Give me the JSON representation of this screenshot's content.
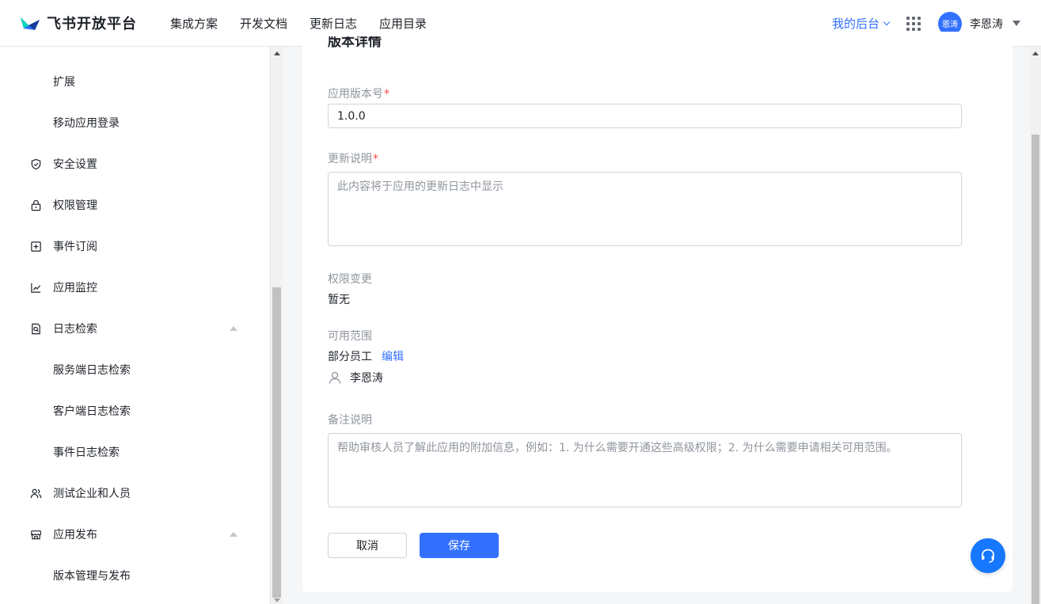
{
  "header": {
    "logo_text": "飞书开放平台",
    "nav": [
      "集成方案",
      "开发文档",
      "更新日志",
      "应用目录"
    ],
    "my_console": "我的后台",
    "avatar_text": "恩涛",
    "user_name": "李恩涛"
  },
  "sidebar": {
    "items": [
      {
        "label": "扩展",
        "icon": "",
        "level": "sub"
      },
      {
        "label": "移动应用登录",
        "icon": "",
        "level": "sub"
      },
      {
        "label": "安全设置",
        "icon": "shield-icon",
        "level": "top"
      },
      {
        "label": "权限管理",
        "icon": "lock-icon",
        "level": "top"
      },
      {
        "label": "事件订阅",
        "icon": "plus-box-icon",
        "level": "top"
      },
      {
        "label": "应用监控",
        "icon": "line-chart-icon",
        "level": "top"
      },
      {
        "label": "日志检索",
        "icon": "log-search-icon",
        "level": "top",
        "expanded": true
      },
      {
        "label": "服务端日志检索",
        "icon": "",
        "level": "sub"
      },
      {
        "label": "客户端日志检索",
        "icon": "",
        "level": "sub"
      },
      {
        "label": "事件日志检索",
        "icon": "",
        "level": "sub"
      },
      {
        "label": "测试企业和人员",
        "icon": "users-icon",
        "level": "top"
      },
      {
        "label": "应用发布",
        "icon": "store-icon",
        "level": "top",
        "expanded": true
      },
      {
        "label": "版本管理与发布",
        "icon": "",
        "level": "sub"
      }
    ]
  },
  "form": {
    "title": "版本详情",
    "version_label": "应用版本号",
    "version_value": "1.0.0",
    "required_mark": "*",
    "notes_label": "更新说明",
    "notes_placeholder": "此内容将于应用的更新日志中显示",
    "permission_label": "权限变更",
    "permission_value": "暂无",
    "scope_label": "可用范围",
    "scope_value": "部分员工",
    "scope_edit": "编辑",
    "scope_member": "李恩涛",
    "remark_label": "备注说明",
    "remark_placeholder": "帮助审核人员了解此应用的附加信息，例如：1. 为什么需要开通这些高级权限；2. 为什么需要申请相关可用范围。",
    "cancel_label": "取消",
    "save_label": "保存"
  },
  "colors": {
    "accent": "#3370ff",
    "required": "#f54a45",
    "help_button": "#1677ff"
  }
}
